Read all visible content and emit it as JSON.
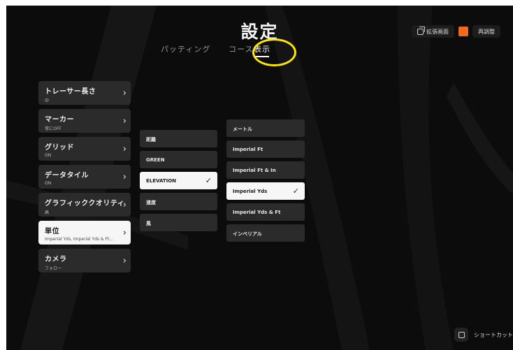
{
  "header": {
    "title": "設定",
    "tabs": [
      {
        "label": "パッティング",
        "active": false
      },
      {
        "label": "コース",
        "active": false
      },
      {
        "label": "表示",
        "active": true
      }
    ]
  },
  "top_right": {
    "expand_label": "拡張画面",
    "readjust_label": "再調整"
  },
  "menu": {
    "items": [
      {
        "label": "トレーサー長さ",
        "value": "中",
        "selected": false
      },
      {
        "label": "マーカー",
        "value": "常にOFF",
        "selected": false
      },
      {
        "label": "グリッド",
        "value": "ON",
        "selected": false
      },
      {
        "label": "データタイル",
        "value": "ON",
        "selected": false
      },
      {
        "label": "グラフィッククオリティ",
        "value": "高",
        "selected": false
      },
      {
        "label": "単位",
        "value": "Imperial Yds, Imperial Yds & Ft...",
        "selected": true
      },
      {
        "label": "カメラ",
        "value": "フォロー",
        "selected": false
      }
    ]
  },
  "submenu": {
    "items": [
      {
        "label": "距離",
        "selected": false
      },
      {
        "label": "GREEN",
        "selected": false
      },
      {
        "label": "ELEVATION",
        "selected": true
      },
      {
        "label": "速度",
        "selected": false
      },
      {
        "label": "風",
        "selected": false
      }
    ]
  },
  "options": {
    "items": [
      {
        "label": "メートル",
        "selected": false
      },
      {
        "label": "Imperial Ft",
        "selected": false
      },
      {
        "label": "Imperial Ft & In",
        "selected": false
      },
      {
        "label": "Imperial Yds",
        "selected": true
      },
      {
        "label": "Imperial Yds & Ft",
        "selected": false
      },
      {
        "label": "インペリアル",
        "selected": false
      }
    ]
  },
  "footer": {
    "shortcut_label": "ショートカット"
  },
  "icons": {
    "chevron": "chevron-right-icon",
    "check": "check-icon",
    "expand": "window-expand-icon",
    "shortcut": "shortcut-icon"
  },
  "colors": {
    "background": "#0c0c0c",
    "tile": "#2b2b2b",
    "tile_selected": "#f6f6f6",
    "accent_orange": "#ef6a1e",
    "highlight": "#ffe600"
  }
}
